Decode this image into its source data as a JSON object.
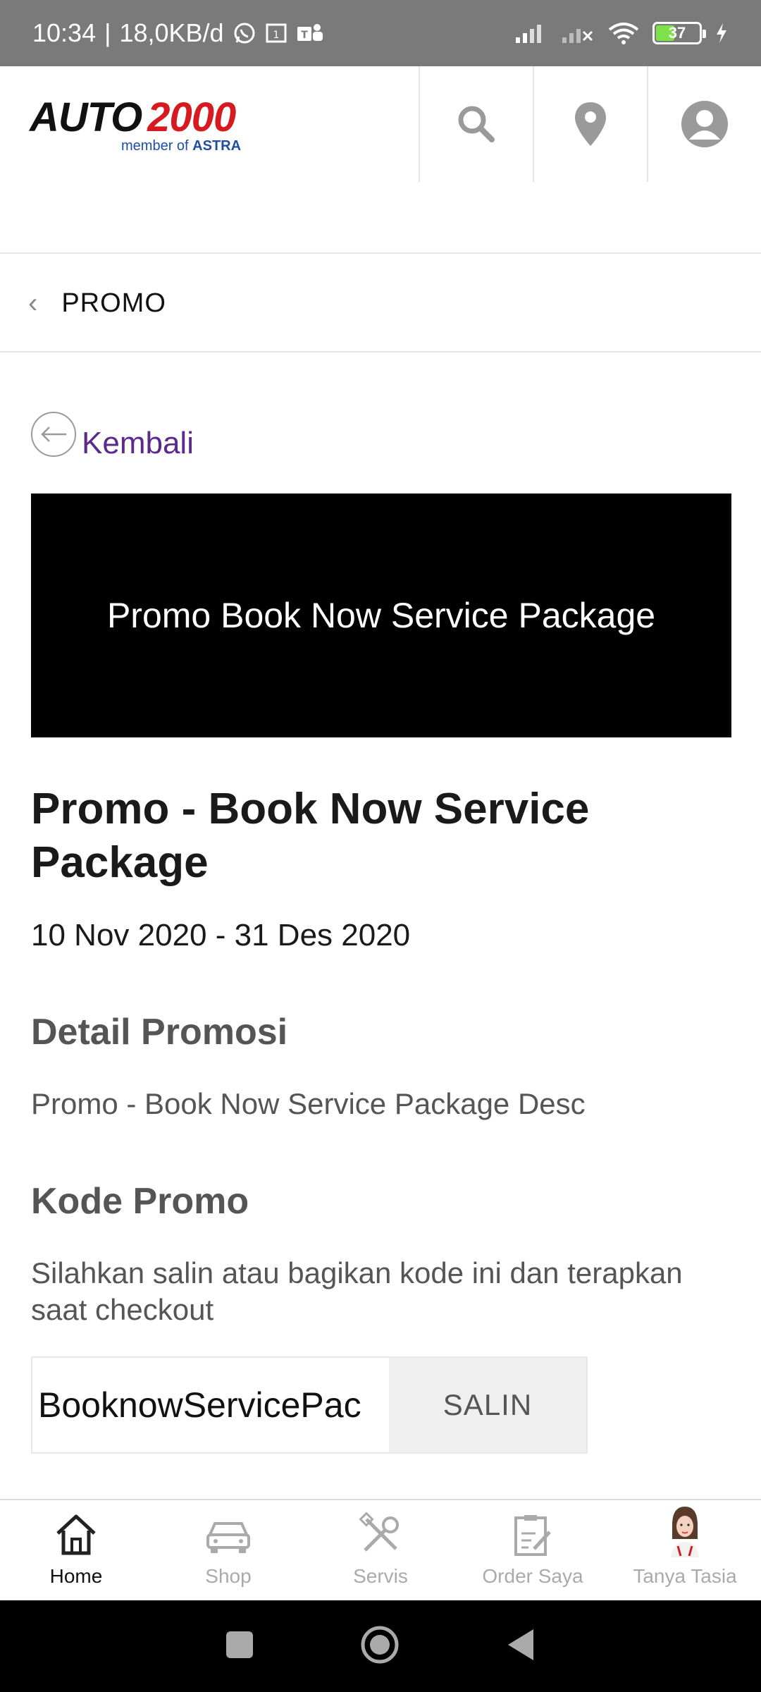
{
  "status_bar": {
    "time": "10:34",
    "network_speed": "18,0KB/d",
    "battery_level": "37",
    "icons": [
      "whatsapp-icon",
      "calendar-icon",
      "teams-icon",
      "signal-icon",
      "signal-no-service-icon",
      "wifi-icon",
      "battery-icon",
      "charging-icon"
    ]
  },
  "header": {
    "logo_brand_left": "AUTO",
    "logo_brand_right": "2000",
    "logo_sub_prefix": "member of",
    "logo_sub_brand": "ASTRA",
    "icons": [
      "search-icon",
      "location-icon",
      "account-icon"
    ]
  },
  "breadcrumb": {
    "label": "PROMO"
  },
  "back": {
    "label": "Kembali"
  },
  "banner": {
    "text": "Promo Book Now Service Package"
  },
  "promo": {
    "title": "Promo - Book Now Service Package",
    "dates": "10 Nov 2020 - 31 Des 2020",
    "detail_heading": "Detail Promosi",
    "detail_text": "Promo - Book Now Service Package Desc",
    "code_heading": "Kode Promo",
    "code_instructions": "Silahkan salin atau bagikan kode ini dan terapkan saat checkout",
    "code_value": "BooknowServicePac",
    "copy_label": "SALIN"
  },
  "bottom_nav": {
    "items": [
      {
        "label": "Home",
        "icon": "home-icon",
        "active": true
      },
      {
        "label": "Shop",
        "icon": "car-icon",
        "active": false
      },
      {
        "label": "Servis",
        "icon": "tools-icon",
        "active": false
      },
      {
        "label": "Order Saya",
        "icon": "order-icon",
        "active": false
      },
      {
        "label": "Tanya Tasia",
        "icon": "assistant-avatar-icon",
        "active": false
      }
    ]
  },
  "colors": {
    "status_bar_bg": "#7a7a7a",
    "link_purple": "#5a2a8c",
    "brand_red": "#d71920",
    "brand_blue": "#1e4fa3"
  }
}
